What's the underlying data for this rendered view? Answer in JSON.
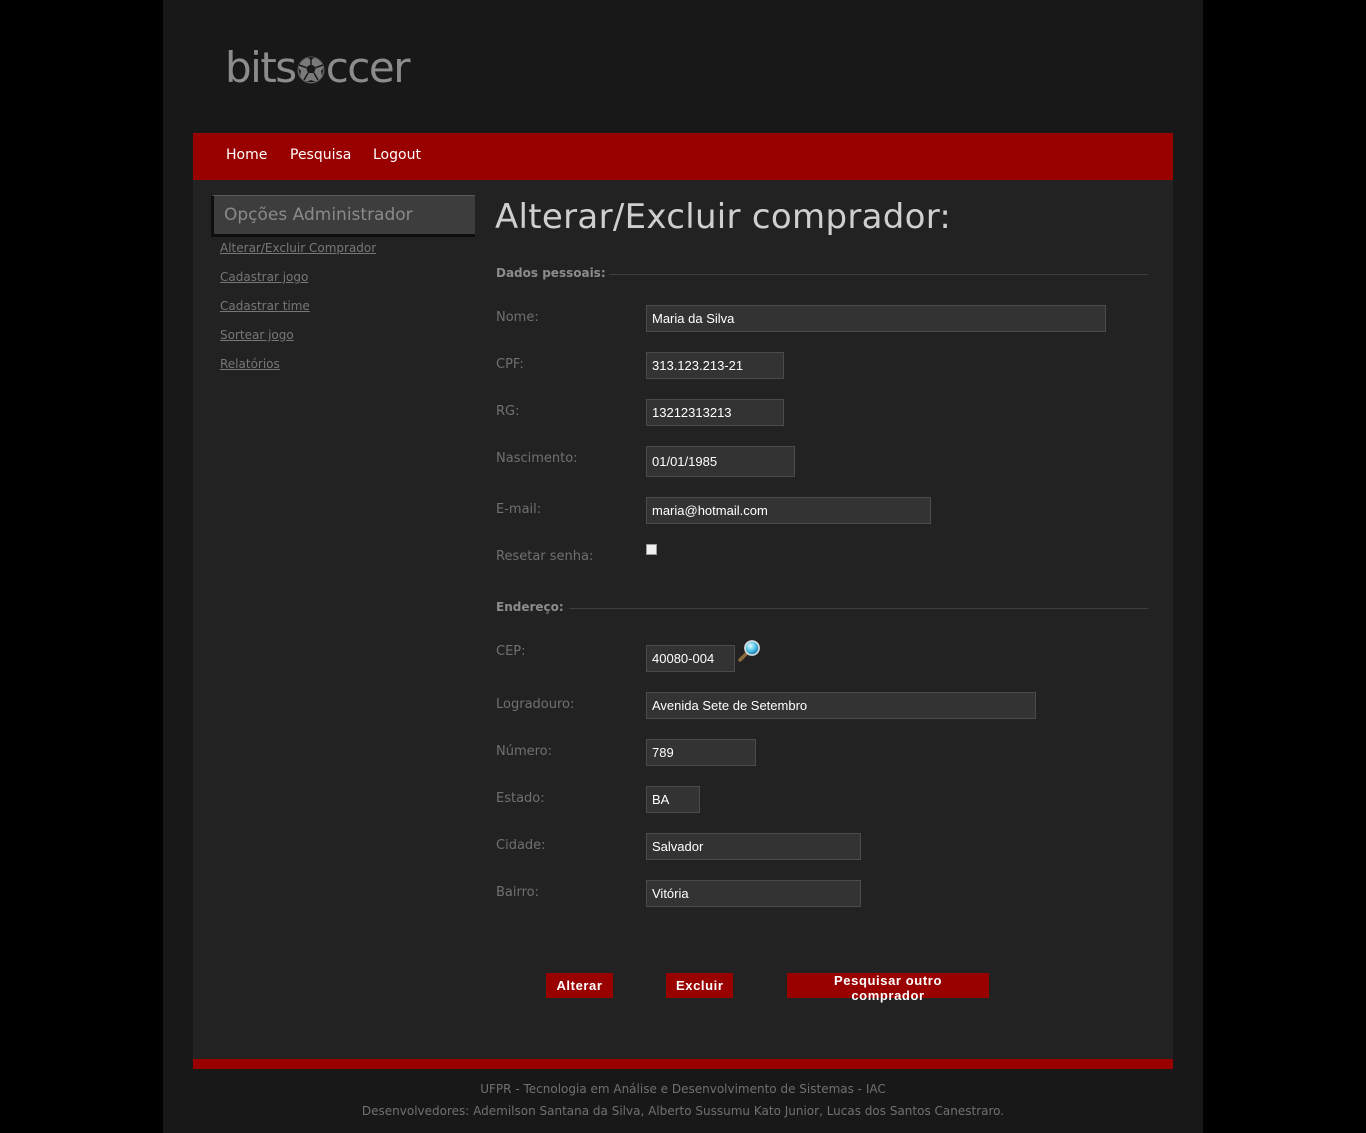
{
  "brand": {
    "logo_left": "bits",
    "logo_right": "ccer"
  },
  "nav": {
    "items": [
      "Home",
      "Pesquisa",
      "Logout"
    ]
  },
  "sidebar": {
    "title": "Opções Administrador",
    "links": [
      "Alterar/Excluir Comprador",
      "Cadastrar jogo",
      "Cadastrar time",
      "Sortear jogo",
      "Relatórios"
    ]
  },
  "main": {
    "title": "Alterar/Excluir comprador:",
    "personal": {
      "heading": "Dados pessoais:",
      "nome": {
        "label": "Nome:",
        "value": "Maria da Silva"
      },
      "cpf": {
        "label": "CPF:",
        "value": "313.123.213-21"
      },
      "rg": {
        "label": "RG:",
        "value": "13212313213"
      },
      "nascimento": {
        "label": "Nascimento:",
        "value": "01/01/1985"
      },
      "email": {
        "label": "E-mail:",
        "value": "maria@hotmail.com"
      },
      "reset": {
        "label": "Resetar senha:",
        "checked": false
      }
    },
    "address": {
      "heading": "Endereço:",
      "cep": {
        "label": "CEP:",
        "value": "40080-004"
      },
      "logradouro": {
        "label": "Logradouro:",
        "value": "Avenida Sete de Setembro"
      },
      "numero": {
        "label": "Número:",
        "value": "789"
      },
      "estado": {
        "label": "Estado:",
        "value": "BA"
      },
      "cidade": {
        "label": "Cidade:",
        "value": "Salvador"
      },
      "bairro": {
        "label": "Bairro:",
        "value": "Vitória"
      }
    },
    "buttons": {
      "alterar": "Alterar",
      "excluir": "Excluir",
      "pesquisar": "Pesquisar outro comprador"
    }
  },
  "footer": {
    "line1": "UFPR - Tecnologia em Análise e Desenvolvimento de Sistemas - IAC",
    "line2": "Desenvolvedores: Ademilson Santana da Silva, Alberto Sussumu Kato Junior, Lucas dos Santos Canestraro."
  },
  "colors": {
    "accent": "#990000",
    "background": "#222222",
    "page": "#181818"
  },
  "icons": [
    "soccer-ball-icon",
    "magnifier-icon"
  ]
}
